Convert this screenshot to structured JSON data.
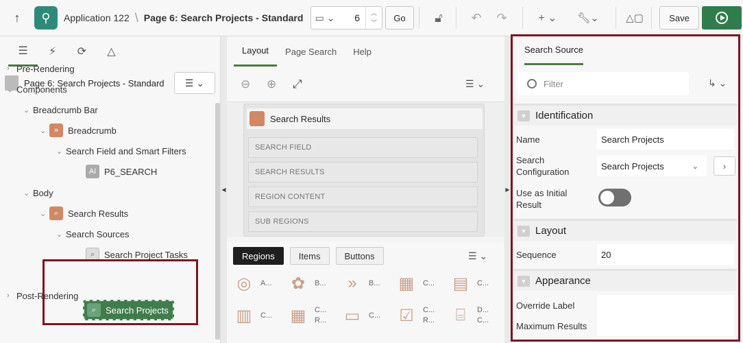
{
  "toolbar": {
    "app_name": "Application 122",
    "separator": "\\",
    "page_name": "Page 6: Search Projects - Standard",
    "page_number": "6",
    "go_label": "Go",
    "save_label": "Save"
  },
  "left_panel": {
    "tabs": [
      "rendering-tab",
      "dynamic-actions-tab",
      "processing-tab",
      "shared-components-tab"
    ],
    "tree_title": "Page 6: Search Projects - Standard",
    "nodes": {
      "pre_rendering": "Pre-Rendering",
      "components": "Components",
      "breadcrumb_bar": "Breadcrumb Bar",
      "breadcrumb": "Breadcrumb",
      "search_field_filters": "Search Field and Smart Filters",
      "p6_search": "P6_SEARCH",
      "body": "Body",
      "search_results": "Search Results",
      "search_sources": "Search Sources",
      "search_project_tasks": "Search Project Tasks",
      "search_projects": "Search Projects",
      "post_rendering": "Post-Rendering"
    }
  },
  "center_panel": {
    "tabs": [
      "Layout",
      "Page Search",
      "Help"
    ],
    "region_title": "Search Results",
    "slots": [
      "SEARCH FIELD",
      "SEARCH RESULTS",
      "REGION CONTENT",
      "SUB REGIONS"
    ],
    "gallery_tabs": [
      "Regions",
      "Items",
      "Buttons"
    ],
    "gallery_items": [
      {
        "label": "A...",
        "icon": "user-circle-icon"
      },
      {
        "label": "B...",
        "icon": "badge-icon"
      },
      {
        "label": "B...",
        "icon": "breadcrumb-chevrons-icon"
      },
      {
        "label": "C...",
        "icon": "calendar-icon"
      },
      {
        "label": "C...",
        "icon": "card-icon"
      },
      {
        "label": "C...",
        "icon": "bar-chart-icon"
      },
      {
        "label": "C... R...",
        "icon": "classic-report-icon"
      },
      {
        "label": "C...",
        "icon": "comments-icon"
      },
      {
        "label": "C... R...",
        "icon": "checklist-icon"
      },
      {
        "label": "D... C...",
        "icon": "dynamic-content-icon"
      }
    ]
  },
  "right_panel": {
    "tab": "Search Source",
    "filter_placeholder": "Filter",
    "sections": {
      "identification": "Identification",
      "layout": "Layout",
      "appearance": "Appearance"
    },
    "props": {
      "name_label": "Name",
      "name_value": "Search Projects",
      "search_config_label": "Search Configuration",
      "search_config_value": "Search Projects",
      "initial_result_label": "Use as Initial Result",
      "initial_result_value": false,
      "sequence_label": "Sequence",
      "sequence_value": "20",
      "override_label_label": "Override Label",
      "override_label_value": "",
      "max_results_label": "Maximum Results",
      "max_results_value": ""
    }
  },
  "colors": {
    "accent_green": "#2f7d4a",
    "highlight_red": "#7a1520",
    "region_orange": "#d28963"
  }
}
